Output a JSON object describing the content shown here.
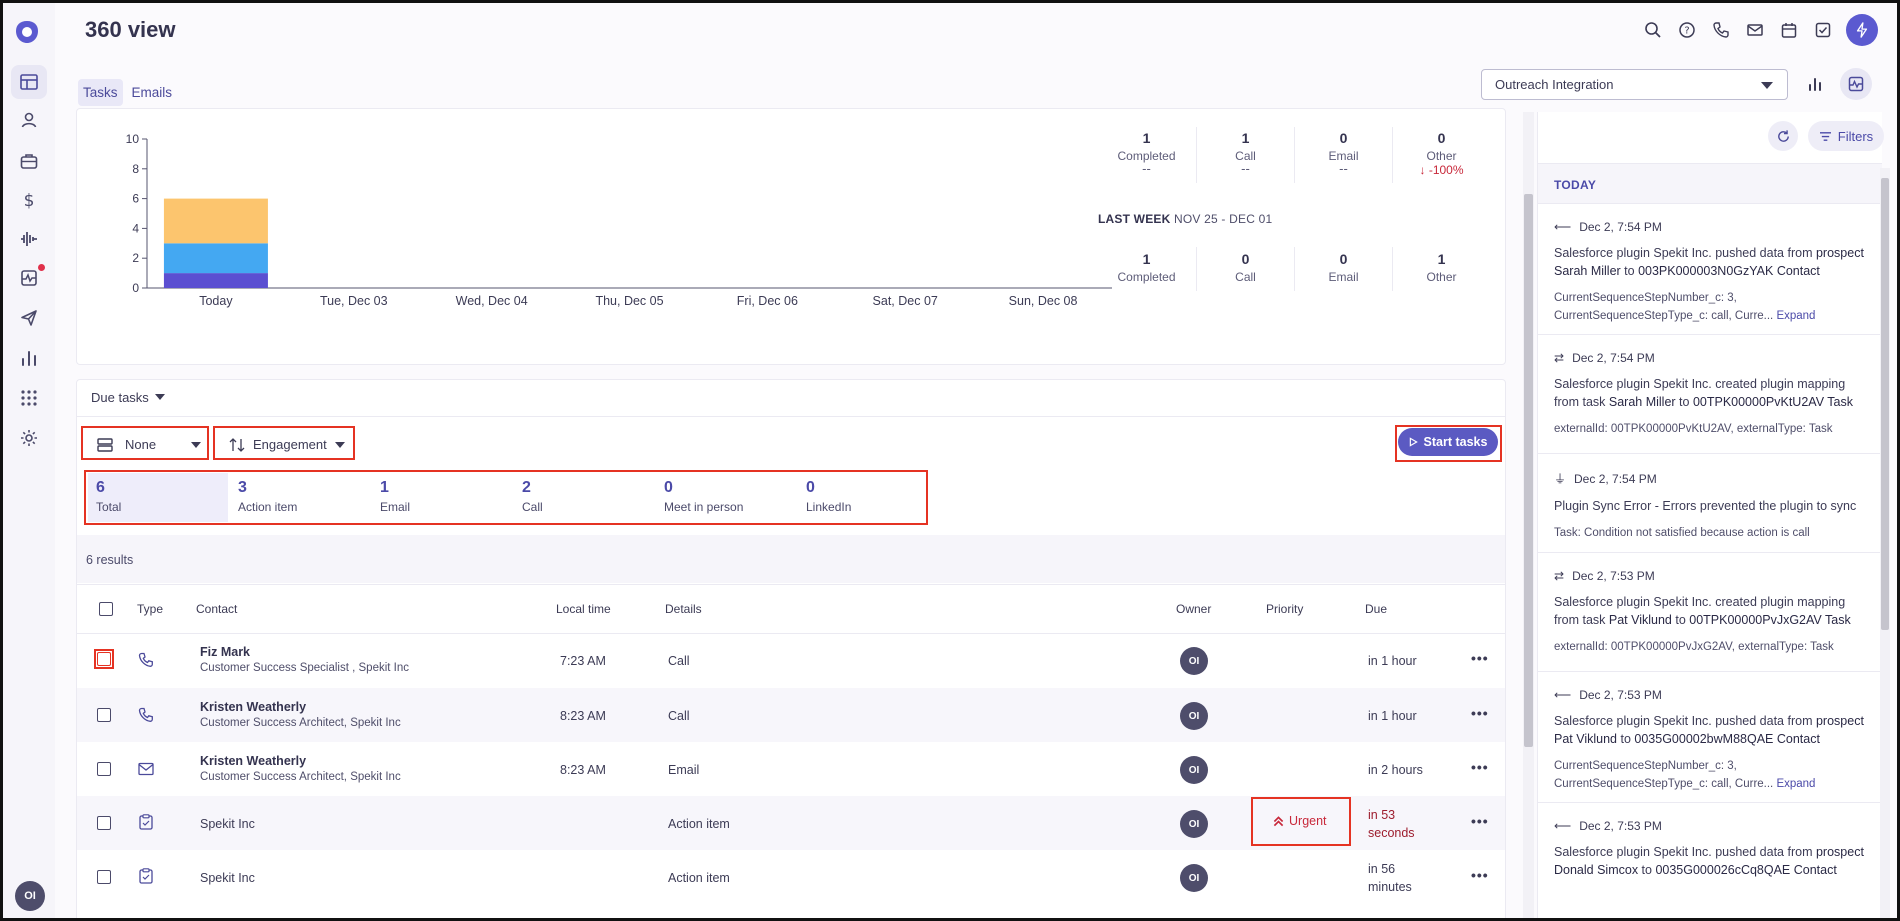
{
  "app": {
    "title": "360 view"
  },
  "tabs": [
    {
      "label": "Tasks"
    },
    {
      "label": "Emails"
    }
  ],
  "integration_select": {
    "value": "Outreach Integration"
  },
  "chart_data": {
    "type": "bar",
    "categories": [
      "Today",
      "Tue, Dec 03",
      "Wed, Dec 04",
      "Thu, Dec 05",
      "Fri, Dec 06",
      "Sat, Dec 07",
      "Sun, Dec 08"
    ],
    "series": [
      {
        "values": [
          1,
          0,
          0,
          0,
          0,
          0,
          0
        ],
        "color": "#5b4fd1"
      },
      {
        "values": [
          2,
          0,
          0,
          0,
          0,
          0,
          0
        ],
        "color": "#44a8f2"
      },
      {
        "values": [
          3,
          0,
          0,
          0,
          0,
          0,
          0
        ],
        "color": "#fcc56e"
      }
    ],
    "ylim": [
      0,
      10
    ],
    "yticks": [
      0,
      2,
      4,
      6,
      8,
      10
    ],
    "stacked": true
  },
  "stats_this_week": [
    {
      "value": "1",
      "label": "Completed",
      "sub": "--",
      "delta": ""
    },
    {
      "value": "1",
      "label": "Call",
      "sub": "--",
      "delta": ""
    },
    {
      "value": "0",
      "label": "Email",
      "sub": "--",
      "delta": ""
    },
    {
      "value": "0",
      "label": "Other",
      "sub": "",
      "delta": "-100%"
    }
  ],
  "last_week": {
    "label": "LAST WEEK",
    "range": "NOV 25 - DEC 01"
  },
  "stats_last_week": [
    {
      "value": "1",
      "label": "Completed"
    },
    {
      "value": "0",
      "label": "Call"
    },
    {
      "value": "0",
      "label": "Email"
    },
    {
      "value": "1",
      "label": "Other"
    }
  ],
  "due_tasks": {
    "title": "Due tasks",
    "group_by": "None",
    "sort_by": "Engagement",
    "start_label": "Start tasks",
    "counts": [
      {
        "num": "6",
        "label": "Total"
      },
      {
        "num": "3",
        "label": "Action item"
      },
      {
        "num": "1",
        "label": "Email"
      },
      {
        "num": "2",
        "label": "Call"
      },
      {
        "num": "0",
        "label": "Meet in person"
      },
      {
        "num": "0",
        "label": "LinkedIn"
      }
    ],
    "results": "6 results",
    "columns": {
      "type": "Type",
      "contact": "Contact",
      "local_time": "Local time",
      "details": "Details",
      "owner": "Owner",
      "priority": "Priority",
      "due": "Due"
    },
    "rows": [
      {
        "type": "call",
        "name": "Fiz Mark",
        "sub": "Customer Success Specialist , Spekit Inc",
        "local_time": "7:23 AM",
        "details": "Call",
        "owner": "OI",
        "priority": "",
        "due": "in 1 hour",
        "due2": ""
      },
      {
        "type": "call",
        "name": "Kristen Weatherly",
        "sub": "Customer Success Architect, Spekit Inc",
        "local_time": "8:23 AM",
        "details": "Call",
        "owner": "OI",
        "priority": "",
        "due": "in 1 hour",
        "due2": ""
      },
      {
        "type": "email",
        "name": "Kristen Weatherly",
        "sub": "Customer Success Architect, Spekit Inc",
        "local_time": "8:23 AM",
        "details": "Email",
        "owner": "OI",
        "priority": "",
        "due": "in 2 hours",
        "due2": ""
      },
      {
        "type": "action",
        "name": "Spekit Inc",
        "sub": "",
        "local_time": "",
        "details": "Action item",
        "owner": "OI",
        "priority": "Urgent",
        "due": "in 53",
        "due2": "seconds"
      },
      {
        "type": "action",
        "name": "Spekit Inc",
        "sub": "",
        "local_time": "",
        "details": "Action item",
        "owner": "OI",
        "priority": "",
        "due": "in 56",
        "due2": "minutes"
      }
    ]
  },
  "activity": {
    "filters_label": "Filters",
    "today_label": "TODAY",
    "items": [
      {
        "icon": "arrow-left-icon",
        "time": "Dec 2, 7:54 PM",
        "text_a": "Salesforce plugin Spekit Inc. pushed data from ",
        "text_b": "prospect",
        "text_c": "Sarah Miller",
        "text_d": " to ",
        "text_e": "003PK000003N0GzYAK Contact",
        "meta": "CurrentSequenceStepNumber_c: 3,",
        "meta2": "CurrentSequenceStepType_c: call, Curre... ",
        "expand": "Expand"
      },
      {
        "icon": "sync-icon",
        "time": "Dec 2, 7:54 PM",
        "text_a": "Salesforce plugin Spekit Inc. created plugin mapping from task ",
        "text_b": "",
        "text_c": "Sarah Miller",
        "text_d": " to ",
        "text_e": "00TPK00000PvKtU2AV Task",
        "meta": "externalId: 00TPK00000PvKtU2AV, externalType: Task",
        "meta2": "",
        "expand": ""
      },
      {
        "icon": "plug-icon",
        "time": "Dec 2, 7:54 PM",
        "text_a": "Plugin Sync Error - Errors prevented the plugin to sync",
        "text_b": "",
        "text_c": "",
        "text_d": "",
        "text_e": "",
        "meta": "Task: Condition not satisfied because action is call",
        "meta2": "",
        "expand": ""
      },
      {
        "icon": "sync-icon",
        "time": "Dec 2, 7:53 PM",
        "text_a": "Salesforce plugin Spekit Inc. created plugin mapping from task ",
        "text_b": "",
        "text_c": "Pat Viklund",
        "text_d": " to ",
        "text_e": "00TPK00000PvJxG2AV Task",
        "meta": "externalId: 00TPK00000PvJxG2AV, externalType: Task",
        "meta2": "",
        "expand": ""
      },
      {
        "icon": "arrow-left-icon",
        "time": "Dec 2, 7:53 PM",
        "text_a": "Salesforce plugin Spekit Inc. pushed data from ",
        "text_b": "prospect",
        "text_c": "Pat Viklund",
        "text_d": " to ",
        "text_e": "0035G00002bwM88QAE Contact",
        "meta": "CurrentSequenceStepNumber_c: 3,",
        "meta2": "CurrentSequenceStepType_c: call, Curre... ",
        "expand": "Expand"
      },
      {
        "icon": "arrow-left-icon",
        "time": "Dec 2, 7:53 PM",
        "text_a": "Salesforce plugin Spekit Inc. pushed data from ",
        "text_b": "prospect",
        "text_c": "Donald Simcox",
        "text_d": " to ",
        "text_e": "0035G000026cCq8QAE Contact",
        "meta": "",
        "meta2": "",
        "expand": ""
      }
    ]
  },
  "user": {
    "initials": "OI"
  }
}
